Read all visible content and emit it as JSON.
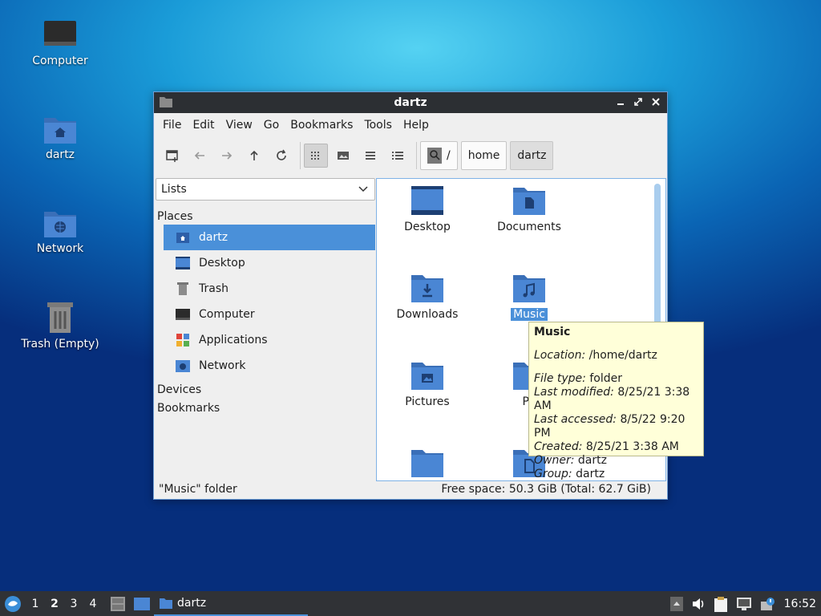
{
  "desktop": {
    "icons": [
      {
        "label": "Computer",
        "icon": "computer-icon"
      },
      {
        "label": "dartz",
        "icon": "home-folder-icon"
      },
      {
        "label": "Network",
        "icon": "network-folder-icon"
      },
      {
        "label": "Trash (Empty)",
        "icon": "trash-icon"
      }
    ]
  },
  "window": {
    "title": "dartz",
    "menu": [
      "File",
      "Edit",
      "View",
      "Go",
      "Bookmarks",
      "Tools",
      "Help"
    ],
    "breadcrumb": [
      "/",
      "home",
      "dartz"
    ],
    "side": {
      "mode": "Lists",
      "places_header": "Places",
      "places": [
        "dartz",
        "Desktop",
        "Trash",
        "Computer",
        "Applications",
        "Network"
      ],
      "devices_header": "Devices",
      "bookmarks_header": "Bookmarks"
    },
    "files": [
      "Desktop",
      "Documents",
      "Downloads",
      "Music",
      "Pictures",
      "Pu"
    ],
    "selected": "Music",
    "status_left": "\"Music\" folder",
    "status_right": "Free space: 50.3 GiB (Total: 62.7 GiB)"
  },
  "tooltip": {
    "title": "Music",
    "location_label": "Location:",
    "location": "/home/dartz",
    "type_label": "File type:",
    "type": "folder",
    "modified_label": "Last modified:",
    "modified": "8/25/21 3:38 AM",
    "accessed_label": "Last accessed:",
    "accessed": "8/5/22 9:20 PM",
    "created_label": "Created:",
    "created": "8/25/21 3:38 AM",
    "owner_label": "Owner:",
    "owner": "dartz",
    "group_label": "Group:",
    "group": "dartz"
  },
  "taskbar": {
    "workspaces": [
      "1",
      "2",
      "3",
      "4"
    ],
    "active_task": "dartz",
    "clock": "16:52"
  },
  "colors": {
    "accent": "#4a90d9",
    "folder": "#4a86d4",
    "titlebar": "#2c2f33",
    "tooltip_bg": "#ffffd9"
  }
}
